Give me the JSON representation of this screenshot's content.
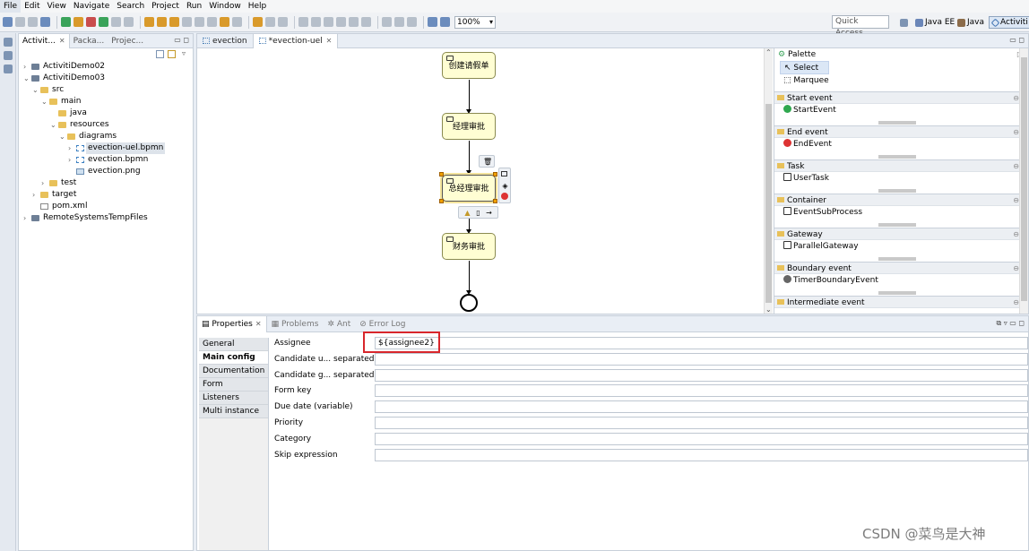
{
  "menu": [
    "File",
    "Edit",
    "View",
    "Navigate",
    "Search",
    "Project",
    "Run",
    "Window",
    "Help"
  ],
  "toolbar": {
    "zoom": "100%",
    "quick_access": "Quick Access"
  },
  "perspectives": [
    {
      "label": "Java EE"
    },
    {
      "label": "Java"
    },
    {
      "label": "Activiti"
    }
  ],
  "explorer": {
    "tabs": [
      "Activit...",
      "Packa...",
      "Projec..."
    ],
    "tree": [
      {
        "label": "ActivitiDemo02",
        "type": "project",
        "expanded": false
      },
      {
        "label": "ActivitiDemo03",
        "type": "project",
        "expanded": true
      },
      {
        "label": "src",
        "type": "folder",
        "expanded": true
      },
      {
        "label": "main",
        "type": "folder",
        "expanded": true
      },
      {
        "label": "java",
        "type": "folder"
      },
      {
        "label": "resources",
        "type": "folder",
        "expanded": true
      },
      {
        "label": "diagrams",
        "type": "folder",
        "expanded": true
      },
      {
        "label": "evection-uel.bpmn",
        "type": "file-bpmn",
        "selected": true
      },
      {
        "label": "evection.bpmn",
        "type": "file-bpmn"
      },
      {
        "label": "evection.png",
        "type": "file-png"
      },
      {
        "label": "test",
        "type": "folder",
        "expanded": false
      },
      {
        "label": "target",
        "type": "folder",
        "expanded": false
      },
      {
        "label": "pom.xml",
        "type": "file-xml"
      },
      {
        "label": "RemoteSystemsTempFiles",
        "type": "project",
        "expanded": false
      }
    ]
  },
  "editor": {
    "tabs": [
      "evection",
      "*evection-uel"
    ],
    "diagram": {
      "tasks": [
        "创建请假单",
        "经理审批",
        "总经理审批",
        "财务审批"
      ],
      "selected_task": "总经理审批"
    }
  },
  "palette": {
    "title": "Palette",
    "tools": [
      "Select",
      "Marquee"
    ],
    "drawers": [
      {
        "label": "Start event",
        "items": [
          "StartEvent"
        ]
      },
      {
        "label": "End event",
        "items": [
          "EndEvent"
        ]
      },
      {
        "label": "Task",
        "items": [
          "UserTask"
        ]
      },
      {
        "label": "Container",
        "items": [
          "EventSubProcess"
        ]
      },
      {
        "label": "Gateway",
        "items": [
          "ParallelGateway"
        ]
      },
      {
        "label": "Boundary event",
        "items": [
          "TimerBoundaryEvent"
        ]
      },
      {
        "label": "Intermediate event",
        "items": []
      }
    ]
  },
  "properties": {
    "tabs": [
      "Properties",
      "Problems",
      "Ant",
      "Error Log"
    ],
    "side_tabs": [
      "General",
      "Main config",
      "Documentation",
      "Form",
      "Listeners",
      "Multi instance"
    ],
    "active_side_tab": "Main config",
    "fields": [
      {
        "label": "Assignee",
        "value": "${assignee2}"
      },
      {
        "label": "Candidate u... separated)",
        "value": ""
      },
      {
        "label": "Candidate g... separated)",
        "value": ""
      },
      {
        "label": "Form key",
        "value": ""
      },
      {
        "label": "Due date (variable)",
        "value": ""
      },
      {
        "label": "Priority",
        "value": ""
      },
      {
        "label": "Category",
        "value": ""
      },
      {
        "label": "Skip expression",
        "value": ""
      }
    ]
  },
  "watermark": "CSDN @菜鸟是大神",
  "colors": {
    "task_fill": "#fffed3",
    "highlight": "#d8262b",
    "selection": "#dde3ea"
  }
}
